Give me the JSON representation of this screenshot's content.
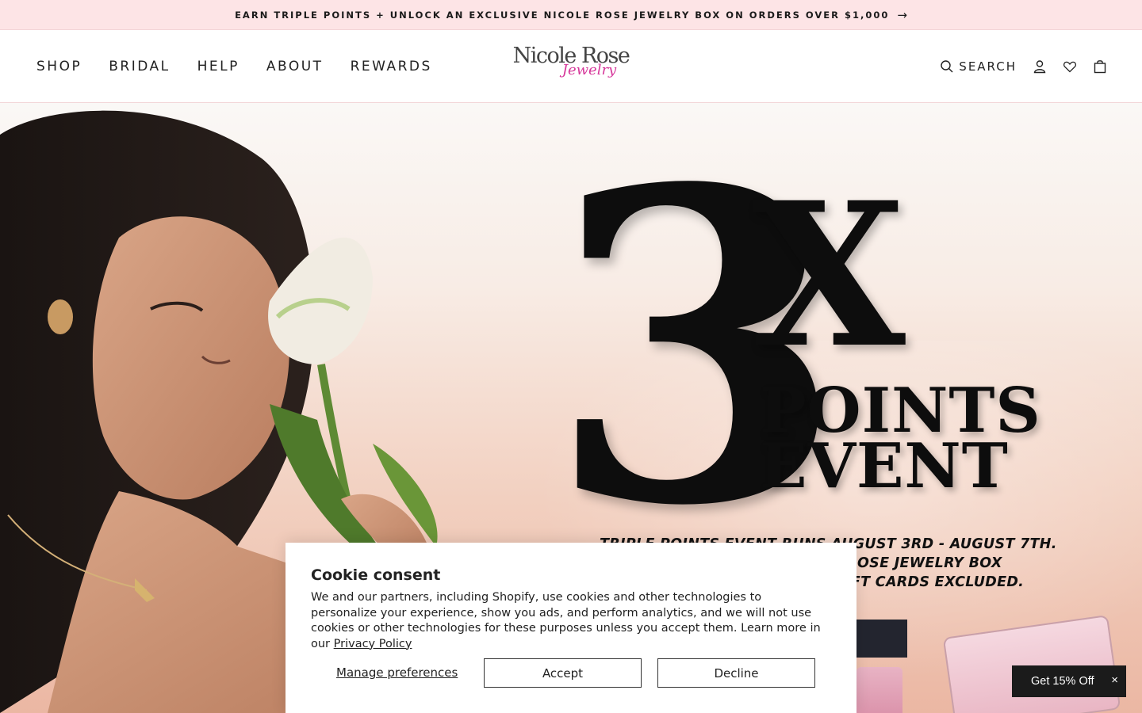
{
  "announcement": {
    "text": "EARN TRIPLE POINTS + UNLOCK AN EXCLUSIVE NICOLE ROSE JEWELRY BOX ON ORDERS OVER $1,000",
    "arrow_icon": "arrow-right-icon"
  },
  "header": {
    "nav": [
      "SHOP",
      "BRIDAL",
      "HELP",
      "ABOUT",
      "REWARDS"
    ],
    "logo": {
      "line1": "Nicole Rose",
      "line2": "Jewelry",
      "accent_color": "#d6379a"
    },
    "search_label": "SEARCH",
    "icons": [
      "search-icon",
      "account-icon",
      "wishlist-heart-icon",
      "cart-bag-icon"
    ]
  },
  "hero": {
    "number": "3",
    "multiplier": "X",
    "line1": "POINTS",
    "line2": "EVENT",
    "terms_line1": "TRIPLE POINTS EVENT RUNS AUGUST 3RD - AUGUST 7TH.",
    "terms_line2": "ICOLE ROSE JEWELRY BOX",
    "terms_line3": "R. GIFT CARDS EXCLUDED."
  },
  "cookie": {
    "title": "Cookie consent",
    "body": "We and our partners, including Shopify, use cookies and other technologies to personalize your experience, show you ads, and perform analytics, and we will not use cookies or other technologies for these purposes unless you accept them. Learn more in our ",
    "privacy_link": "Privacy Policy",
    "manage_label": "Manage preferences",
    "accept_label": "Accept",
    "decline_label": "Decline"
  },
  "promo": {
    "label": "Get 15% Off",
    "close": "×"
  }
}
